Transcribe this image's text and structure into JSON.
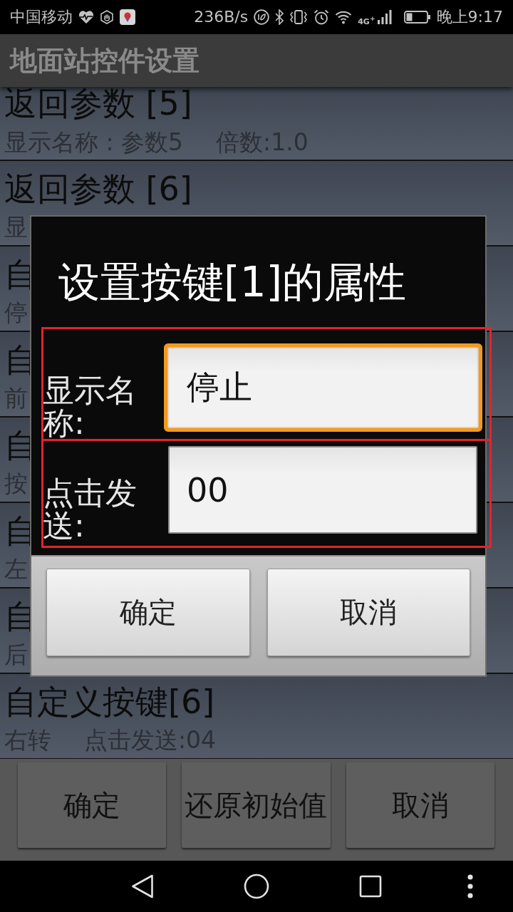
{
  "status_bar": {
    "carrier": "中国移动",
    "speed": "236B/s",
    "network_type": "4G$^{+}$",
    "time": "晚上9:17"
  },
  "app_bar": {
    "title": "地面站控件设置"
  },
  "list": [
    {
      "title": "返回参数 [5]",
      "details": [
        "显示名称 : 参数5",
        "倍数:1.0"
      ]
    },
    {
      "title": "返回参数 [6]",
      "details": [
        "显"
      ]
    },
    {
      "title": "自",
      "details": [
        "停"
      ]
    },
    {
      "title": "自",
      "details": [
        "前"
      ]
    },
    {
      "title": "自",
      "details": [
        "按"
      ]
    },
    {
      "title": "自",
      "details": [
        "左"
      ]
    },
    {
      "title": "自",
      "details": [
        "后"
      ]
    },
    {
      "title": "自定义按键[6]",
      "details": [
        "右转",
        "点击发送:04"
      ]
    }
  ],
  "bottom_buttons": [
    "确定",
    "还原初始值",
    "取消"
  ],
  "dialog": {
    "title": "设置按键[1]的属性",
    "fields": [
      {
        "label": "显示名称:",
        "value": "停止",
        "focused": true,
        "highlighted": true
      },
      {
        "label": "点击发送:",
        "value": "00",
        "focused": false,
        "highlighted": true
      }
    ],
    "buttons": [
      "确定",
      "取消"
    ]
  }
}
